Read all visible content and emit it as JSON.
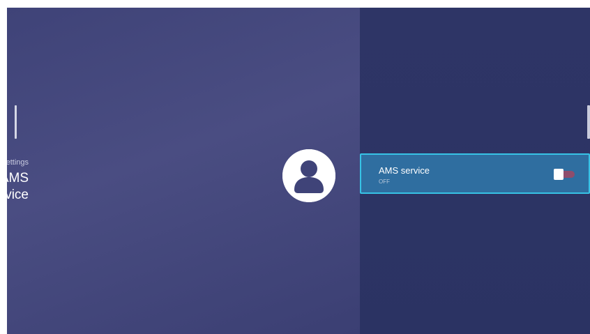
{
  "header": {
    "breadcrumb": "Settings",
    "title": "AMS service"
  },
  "settings_list": {
    "items": [
      {
        "label": "AMS service",
        "status": "OFF",
        "toggle_on": false
      }
    ]
  },
  "icons": {
    "avatar": "account-icon"
  },
  "colors": {
    "left_panel": "#45487d",
    "right_panel": "#2e3566",
    "row_highlight": "#2f6ea0",
    "focus_border": "#37c3e6",
    "toggle_track": "#8f4d6c"
  }
}
